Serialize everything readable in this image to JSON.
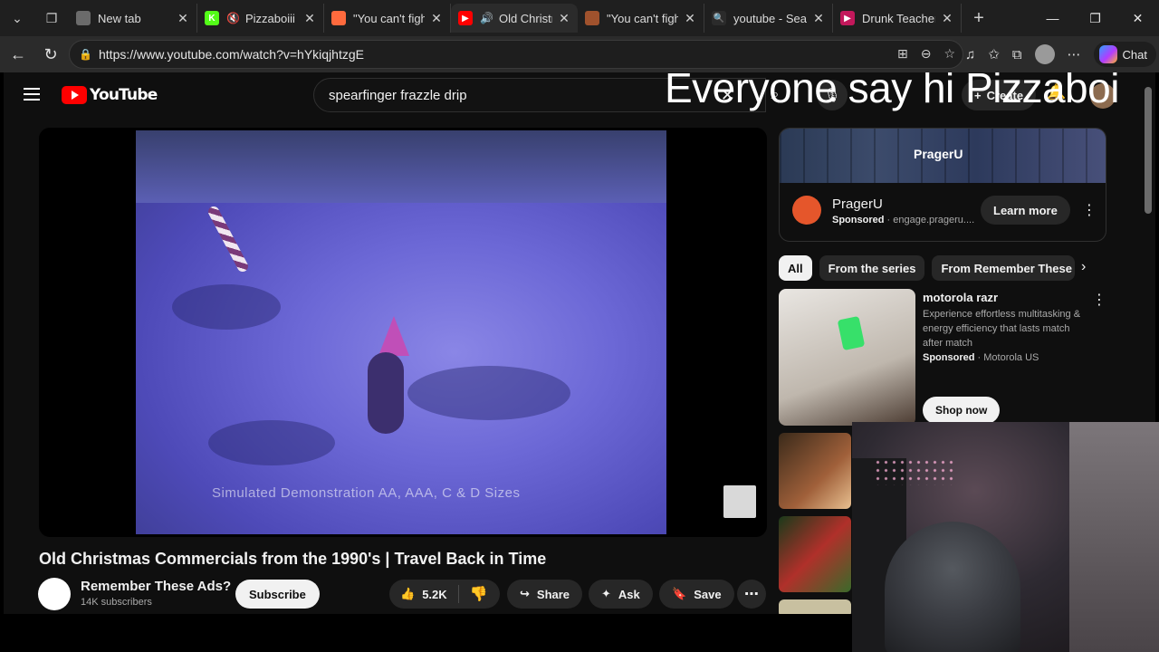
{
  "browser": {
    "tabs": [
      {
        "title": "New tab",
        "favicon_color": "#6b6b6b",
        "favicon_glyph": "",
        "muted": false,
        "active": false
      },
      {
        "title": "Pizzaboiii S",
        "favicon_color": "#53fc18",
        "favicon_glyph": "K",
        "muted": true,
        "active": false
      },
      {
        "title": "\"You can't fight",
        "favicon_color": "#ff6a3d",
        "favicon_glyph": "",
        "muted": false,
        "active": false
      },
      {
        "title": "Old Christm",
        "favicon_color": "#ff0000",
        "favicon_glyph": "▶",
        "muted": false,
        "active": true
      },
      {
        "title": "\"You can't fight",
        "favicon_color": "#a0522d",
        "favicon_glyph": "",
        "muted": false,
        "active": false
      },
      {
        "title": "youtube - Searc",
        "favicon_color": "#2b2b2b",
        "favicon_glyph": "🔍",
        "muted": false,
        "active": false
      },
      {
        "title": "Drunk Teacher's",
        "favicon_color": "#c2185b",
        "favicon_glyph": "▶",
        "muted": false,
        "active": false
      }
    ],
    "url": "https://www.youtube.com/watch?v=hYkiqjhtzgE",
    "copilot_label": "Chat"
  },
  "youtube": {
    "logo_text": "YouTube",
    "search_query": "spearfinger frazzle drip",
    "create_label": "Create",
    "stream_overlay": "Everyone say hi Pizzaboi",
    "video": {
      "caption": "Simulated Demonstration AA, AAA, C & D Sizes",
      "title": "Old Christmas Commercials from the 1990's | Travel Back in Time",
      "channel": "Remember These Ads?",
      "subscribers": "14K subscribers",
      "subscribe_label": "Subscribe",
      "likes": "5.2K",
      "share_label": "Share",
      "ask_label": "Ask",
      "save_label": "Save"
    },
    "ad": {
      "banner_brand": "PragerU",
      "name": "PragerU",
      "sponsored": "Sponsored",
      "domain": "· engage.prageru....",
      "cta": "Learn more"
    },
    "chips": [
      "All",
      "From the series",
      "From Remember These A"
    ],
    "promo": {
      "title": "motorola razr",
      "description": "Experience effortless multitasking & energy efficiency that lasts match after match",
      "sponsored": "Sponsored",
      "advertiser": "· Motorola US",
      "cta": "Shop now"
    }
  }
}
